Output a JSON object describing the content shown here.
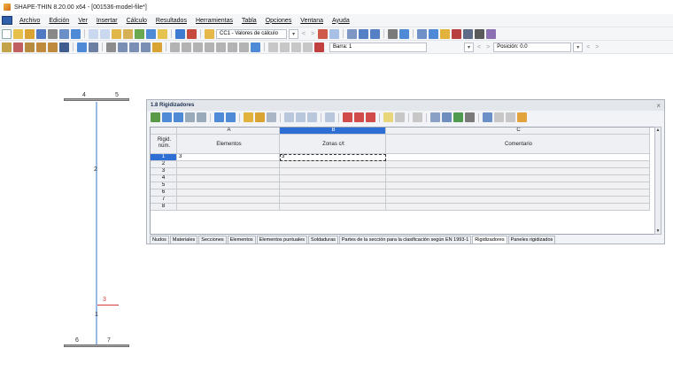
{
  "window": {
    "title": "SHAPE-THIN 8.20.00 x64 - [001536-model-file*]"
  },
  "menu": [
    "Archivo",
    "Edición",
    "Ver",
    "Insertar",
    "Cálculo",
    "Resultados",
    "Herramientas",
    "Tabla",
    "Opciones",
    "Ventana",
    "Ayuda"
  ],
  "toolbar1": {
    "load_case": "CC1 - Valores de cálculo"
  },
  "toolbar2": {
    "bar_combo": "Barra: 1",
    "position": "Posición: 0.0"
  },
  "drawing": {
    "node_labels": [
      "4",
      "5",
      "2",
      "3",
      "1",
      "6",
      "7"
    ]
  },
  "panel": {
    "title": "1.8 Rigidizadores",
    "close": "×",
    "columns": {
      "letters": [
        "A",
        "B",
        "C"
      ],
      "rowhead": "Rigid.\nnúm.",
      "names": [
        "Elementos",
        "Zonas c/t",
        "Comentario"
      ]
    },
    "rows": [
      {
        "num": "1",
        "a": "3",
        "b": "3",
        "c": ""
      },
      {
        "num": "2",
        "a": "",
        "b": "",
        "c": ""
      },
      {
        "num": "3",
        "a": "",
        "b": "",
        "c": ""
      },
      {
        "num": "4",
        "a": "",
        "b": "",
        "c": ""
      },
      {
        "num": "5",
        "a": "",
        "b": "",
        "c": ""
      },
      {
        "num": "6",
        "a": "",
        "b": "",
        "c": ""
      },
      {
        "num": "7",
        "a": "",
        "b": "",
        "c": ""
      },
      {
        "num": "8",
        "a": "",
        "b": "",
        "c": ""
      }
    ],
    "tabs": [
      "Nudos",
      "Materiales",
      "Secciones",
      "Elementos",
      "Elementos puntuales",
      "Soldaduras",
      "Partes de la sección para la clasificación según EN 1993-1",
      "Rigidizadores",
      "Paneles rigidizados"
    ],
    "active_tab": "Rigidizadores"
  }
}
